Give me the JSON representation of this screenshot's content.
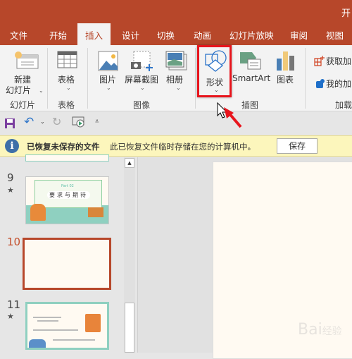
{
  "window": {
    "title": "开"
  },
  "tabs": [
    {
      "label": "文件"
    },
    {
      "label": "开始"
    },
    {
      "label": "插入",
      "active": true
    },
    {
      "label": "设计"
    },
    {
      "label": "切换"
    },
    {
      "label": "动画"
    },
    {
      "label": "幻灯片放映"
    },
    {
      "label": "审阅"
    },
    {
      "label": "视图"
    }
  ],
  "ribbon": {
    "new_slide_1": "新建",
    "new_slide_2": "幻灯片",
    "group_slides": "幻灯片",
    "table": "表格",
    "group_table": "表格",
    "picture": "图片",
    "screenshot": "屏幕截图",
    "album": "相册",
    "group_images": "图像",
    "shapes": "形状",
    "smartart": "SmartArt",
    "chart": "图表",
    "group_illustrations": "插图",
    "get_addins": "获取加",
    "my_addins": "我的加",
    "group_addins": "加载"
  },
  "infobar": {
    "title": "已恢复未保存的文件",
    "message": "此已恢复文件临时存储在您的计算机中。",
    "save_button": "保存"
  },
  "slides": [
    {
      "number": "9",
      "title": "Part 02",
      "heading": "要求与期待"
    },
    {
      "number": "10",
      "selected": true
    },
    {
      "number": "11"
    }
  ],
  "colors": {
    "accent": "#b7472a",
    "highlight": "#e8141c",
    "infobar": "#fcf6bc"
  }
}
